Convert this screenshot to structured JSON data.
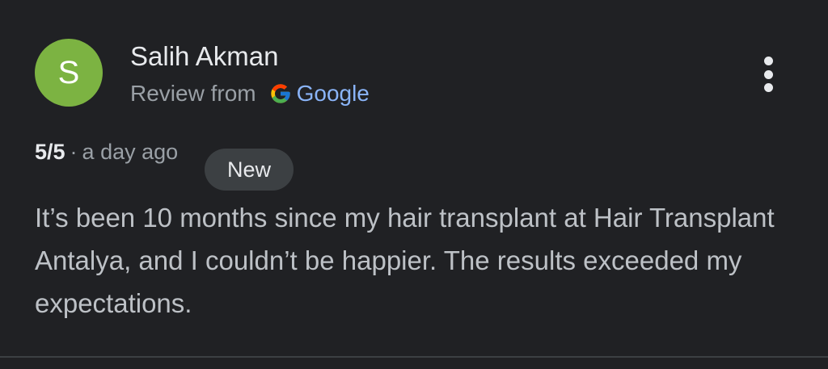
{
  "reviewer": {
    "avatar_letter": "S",
    "name": "Salih Akman"
  },
  "source": {
    "prefix": "Review from",
    "provider": "Google"
  },
  "meta": {
    "rating": "5/5",
    "separator": "·",
    "time": "a day ago",
    "badge": "New"
  },
  "review": {
    "text": "It’s been 10 months since my hair transplant at Hair Transplant Antalya, and I couldn’t be happier. The results exceeded my expectations."
  },
  "colors": {
    "avatar": "#7cb342",
    "link": "#8ab4f8",
    "background": "#202124"
  },
  "icons": {
    "menu": "more-vertical-icon",
    "provider_logo": "google-g-logo"
  }
}
